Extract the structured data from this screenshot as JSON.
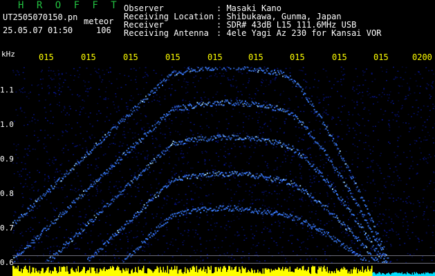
{
  "app": {
    "title": "H R O F F T",
    "title_color": "#22c040"
  },
  "file": {
    "name": "UT2505070150.pn",
    "suffix": "meteor",
    "datetime": "25.05.07 01:50",
    "count": "106"
  },
  "info": [
    {
      "key": "Observer",
      "value": ": Masaki Kano"
    },
    {
      "key": "Receiving Location",
      "value": ": Shibukawa, Gunma, Japan"
    },
    {
      "key": "Receiver",
      "value": ": SDR# 43dB L15 111.6MHz USB"
    },
    {
      "key": "Receiving Antenna",
      "value": ": 4ele Yagi Az 230 for Kansai VOR"
    }
  ],
  "axis": {
    "unit": "kHz",
    "y_labels": [
      "1.1",
      "1.0",
      "0.9",
      "0.8",
      "0.7",
      "0.6"
    ],
    "time_labels": [
      "015",
      "015",
      "015",
      "015",
      "015",
      "015",
      "015",
      "015",
      "015",
      "0200"
    ]
  },
  "colors": {
    "background": "#000000",
    "noise": "#0a1ab0",
    "trace": "#3a7cff",
    "trace_hot": "#9fd8ff",
    "tick_text": "#ffff00",
    "baseline": "#ffff00",
    "baseline_low": "#00e0ff"
  }
}
